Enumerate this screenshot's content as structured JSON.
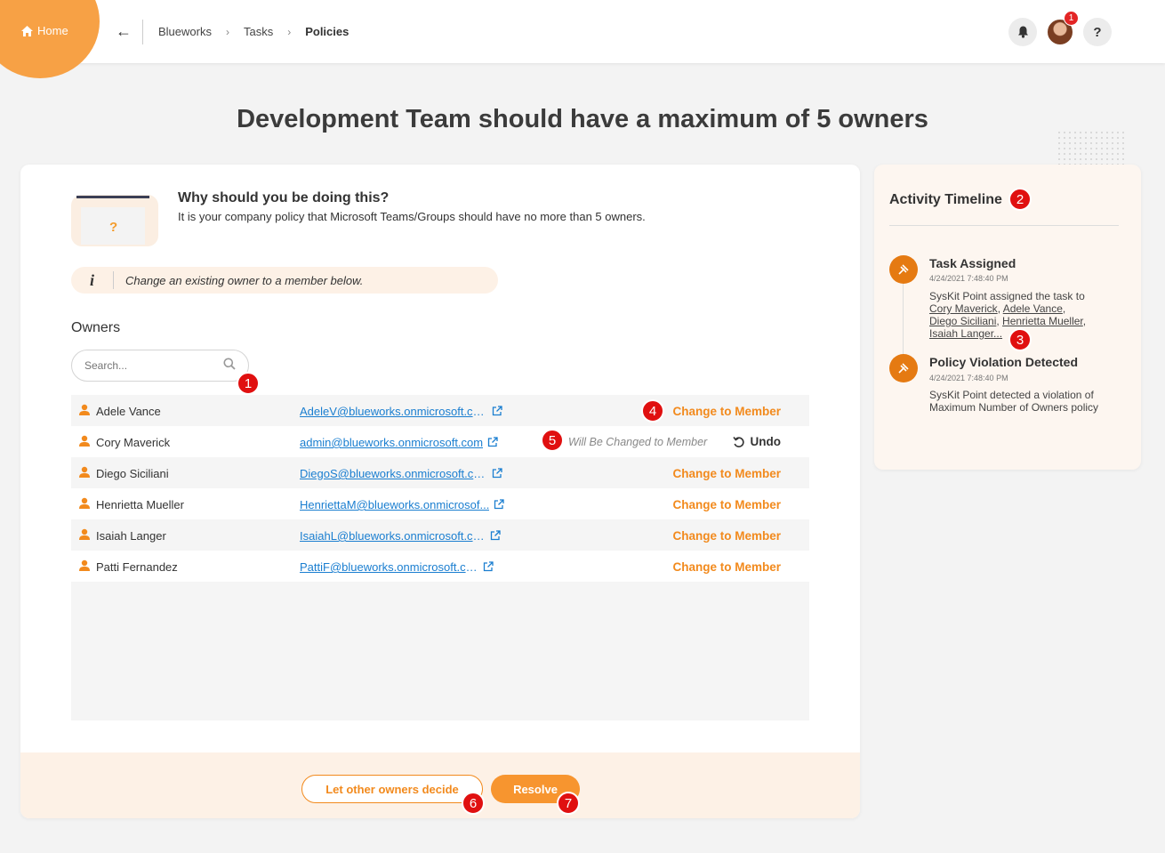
{
  "header": {
    "home_label": "Home",
    "breadcrumbs": [
      "Blueworks",
      "Tasks",
      "Policies"
    ],
    "notification_count": "1",
    "help_label": "?"
  },
  "page": {
    "title": "Development Team should have a maximum of 5 owners"
  },
  "why": {
    "title": "Why should you be doing this?",
    "text": "It is your company policy that Microsoft Teams/Groups should have no more than 5 owners.",
    "illustration_glyph": "?"
  },
  "info": {
    "icon": "i",
    "text": "Change an existing owner to a member below."
  },
  "owners": {
    "label": "Owners",
    "search_placeholder": "Search...",
    "rows": [
      {
        "name": "Adele Vance",
        "email": "AdeleV@blueworks.onmicrosoft.com",
        "action": "Change to Member"
      },
      {
        "name": "Cory Maverick",
        "email": "admin@blueworks.onmicrosoft.com",
        "pending": "Will Be Changed to Member",
        "action": "Undo"
      },
      {
        "name": "Diego Siciliani",
        "email": "DiegoS@blueworks.onmicrosoft.com",
        "action": "Change to Member"
      },
      {
        "name": "Henrietta Mueller",
        "email": "HenriettaM@blueworks.onmicrosof...",
        "action": "Change to Member"
      },
      {
        "name": "Isaiah Langer",
        "email": "IsaiahL@blueworks.onmicrosoft.com",
        "action": "Change to Member"
      },
      {
        "name": "Patti Fernandez",
        "email": "PattiF@blueworks.onmicrosoft.com",
        "action": "Change to Member"
      }
    ]
  },
  "footer": {
    "secondary_label": "Let other owners decide",
    "primary_label": "Resolve"
  },
  "timeline": {
    "title": "Activity Timeline",
    "events": [
      {
        "title": "Task Assigned",
        "date": "4/24/2021 7:48:40 PM",
        "desc_prefix": "SysKit Point assigned the task to",
        "people": [
          "Cory Maverick",
          "Adele Vance",
          "Diego Siciliani",
          "Henrietta Mueller",
          "Isaiah Langer..."
        ]
      },
      {
        "title": "Policy Violation Detected",
        "date": "4/24/2021 7:48:40 PM",
        "desc": "SysKit Point detected a violation of Maximum Number of Owners policy"
      }
    ]
  },
  "callouts": [
    "1",
    "2",
    "3",
    "4",
    "5",
    "6",
    "7"
  ],
  "colors": {
    "accent": "#f28a1d",
    "link": "#1a7ed0",
    "callout": "#e01010",
    "timeline_dot": "#e57a12"
  }
}
